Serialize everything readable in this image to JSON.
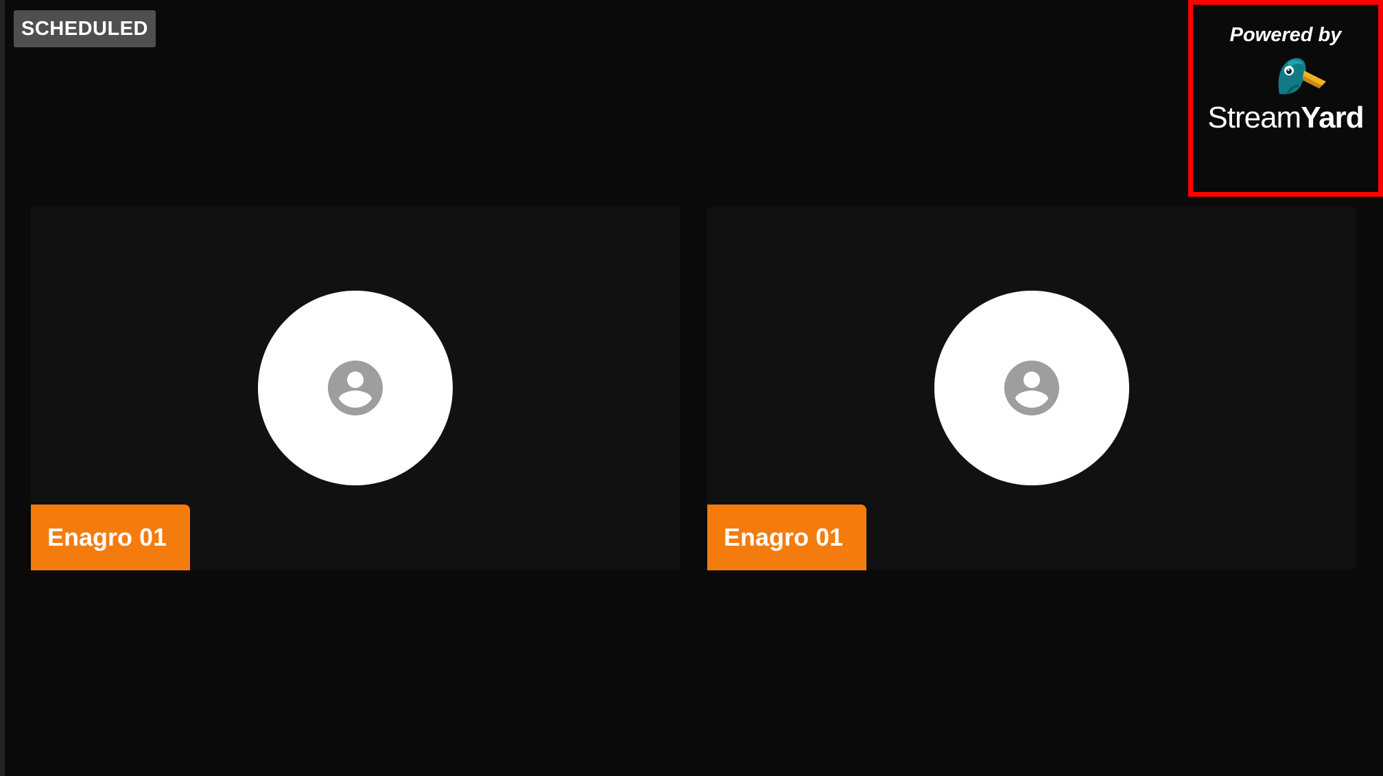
{
  "status_badge": {
    "label": "SCHEDULED"
  },
  "branding": {
    "powered_by": "Powered by",
    "brand_part1": "Stream",
    "brand_part2": "Yard",
    "highlight_color": "#ff0000"
  },
  "participants": [
    {
      "name": "Enagro 01",
      "avatar_icon": "user-icon"
    },
    {
      "name": "Enagro 01",
      "avatar_icon": "user-icon"
    }
  ],
  "colors": {
    "background": "#0a0a0a",
    "tile": "#111111",
    "name_tag": "#f47c0e",
    "badge": "#4f4f4f"
  }
}
